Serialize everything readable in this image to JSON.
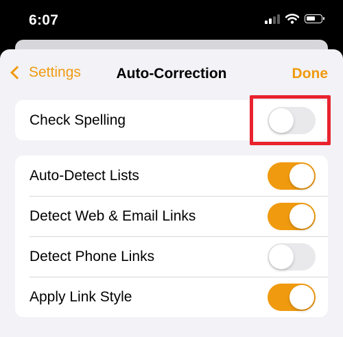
{
  "status_bar": {
    "time": "6:07"
  },
  "nav": {
    "back_label": "Settings",
    "title": "Auto-Correction",
    "done_label": "Done"
  },
  "accent_color": "#f09a0f",
  "highlight_color": "#e8232e",
  "check_spelling": {
    "label": "Check Spelling",
    "enabled": false
  },
  "settings": [
    {
      "label": "Auto-Detect Lists",
      "enabled": true
    },
    {
      "label": "Detect Web & Email Links",
      "enabled": true
    },
    {
      "label": "Detect Phone Links",
      "enabled": false
    },
    {
      "label": "Apply Link Style",
      "enabled": true
    }
  ]
}
